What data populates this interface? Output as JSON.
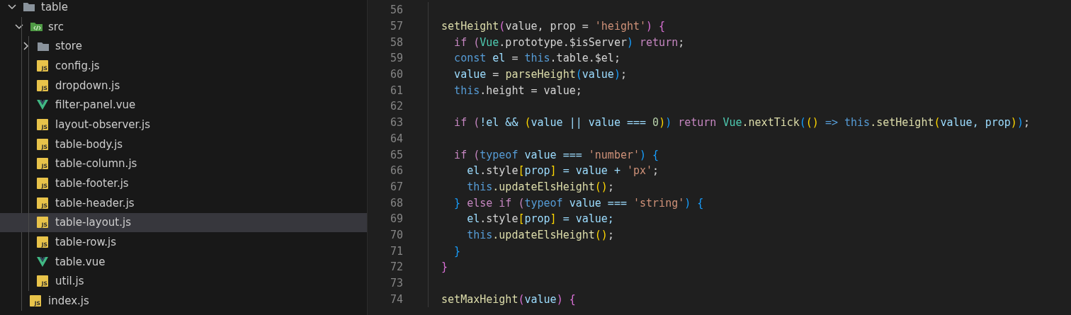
{
  "explorer": {
    "items": [
      {
        "label": "table",
        "kind": "folder",
        "expanded": true,
        "selected": false,
        "children": [
          {
            "label": "src",
            "kind": "source-folder",
            "expanded": true,
            "selected": false,
            "children": [
              {
                "label": "store",
                "kind": "folder",
                "expanded": false,
                "selected": false
              },
              {
                "label": "config.js",
                "kind": "js",
                "icon_text": "JS",
                "selected": false
              },
              {
                "label": "dropdown.js",
                "kind": "js",
                "icon_text": "JS",
                "selected": false
              },
              {
                "label": "filter-panel.vue",
                "kind": "vue",
                "selected": false
              },
              {
                "label": "layout-observer.js",
                "kind": "js",
                "icon_text": "JS",
                "selected": false
              },
              {
                "label": "table-body.js",
                "kind": "js",
                "icon_text": "JS",
                "selected": false
              },
              {
                "label": "table-column.js",
                "kind": "js",
                "icon_text": "JS",
                "selected": false
              },
              {
                "label": "table-footer.js",
                "kind": "js",
                "icon_text": "JS",
                "selected": false
              },
              {
                "label": "table-header.js",
                "kind": "js",
                "icon_text": "JS",
                "selected": false
              },
              {
                "label": "table-layout.js",
                "kind": "js",
                "icon_text": "JS",
                "selected": true
              },
              {
                "label": "table-row.js",
                "kind": "js",
                "icon_text": "JS",
                "selected": false
              },
              {
                "label": "table.vue",
                "kind": "vue",
                "selected": false
              },
              {
                "label": "util.js",
                "kind": "js",
                "icon_text": "JS",
                "selected": false
              }
            ]
          },
          {
            "label": "index.js",
            "kind": "js",
            "icon_text": "JS",
            "selected": false
          }
        ]
      }
    ]
  },
  "editor": {
    "lines": [
      {
        "number": "56"
      },
      {
        "number": "57",
        "tokens": [
          {
            "text": "  setHeight",
            "kind": "fn"
          },
          {
            "text": "(",
            "kind": "b2"
          },
          {
            "text": "value, prop = ",
            "kind": "plain"
          },
          {
            "text": "'height'",
            "kind": "str"
          },
          {
            "text": ") {",
            "kind": "b2"
          }
        ]
      },
      {
        "number": "58",
        "tokens": [
          {
            "text": "    if (",
            "kind": "ctl"
          },
          {
            "text": "Vue",
            "kind": "cls"
          },
          {
            "text": ".prototype.$isServer",
            "kind": "plain"
          },
          {
            "text": ") ",
            "kind": "b3"
          },
          {
            "text": "return",
            "kind": "ctl"
          },
          {
            "text": ";",
            "kind": "plain"
          }
        ]
      },
      {
        "number": "59",
        "tokens": [
          {
            "text": "    const",
            "kind": "kw"
          },
          {
            "text": " el",
            "kind": "var"
          },
          {
            "text": " = ",
            "kind": "plain"
          },
          {
            "text": "this",
            "kind": "kw"
          },
          {
            "text": ".table.$el;",
            "kind": "plain"
          }
        ]
      },
      {
        "number": "60",
        "tokens": [
          {
            "text": "    value",
            "kind": "var"
          },
          {
            "text": " = ",
            "kind": "plain"
          },
          {
            "text": "parseHeight",
            "kind": "fn"
          },
          {
            "text": "(",
            "kind": "b3"
          },
          {
            "text": "value",
            "kind": "var"
          },
          {
            "text": ")",
            "kind": "b3"
          },
          {
            "text": ";",
            "kind": "plain"
          }
        ]
      },
      {
        "number": "61",
        "tokens": [
          {
            "text": "    this",
            "kind": "kw"
          },
          {
            "text": ".height = value;",
            "kind": "plain"
          }
        ]
      },
      {
        "number": "62"
      },
      {
        "number": "63",
        "tokens": [
          {
            "text": "    if (",
            "kind": "ctl"
          },
          {
            "text": "!el && ",
            "kind": "var"
          },
          {
            "text": "(",
            "kind": "b1"
          },
          {
            "text": "value || value === ",
            "kind": "var"
          },
          {
            "text": "0",
            "kind": "num"
          },
          {
            "text": ")",
            "kind": "b1"
          },
          {
            "text": ") ",
            "kind": "b3"
          },
          {
            "text": "return ",
            "kind": "ctl"
          },
          {
            "text": "Vue",
            "kind": "cls"
          },
          {
            "text": ".nextTick",
            "kind": "fn"
          },
          {
            "text": "(",
            "kind": "b3"
          },
          {
            "text": "()",
            "kind": "b1"
          },
          {
            "text": " => this",
            "kind": "kw"
          },
          {
            "text": ".setHeight",
            "kind": "fn"
          },
          {
            "text": "(",
            "kind": "b1"
          },
          {
            "text": "value, prop",
            "kind": "var"
          },
          {
            "text": ")",
            "kind": "b1"
          },
          {
            "text": ")",
            "kind": "b3"
          },
          {
            "text": ";",
            "kind": "plain"
          }
        ]
      },
      {
        "number": "64"
      },
      {
        "number": "65",
        "tokens": [
          {
            "text": "    if (",
            "kind": "ctl"
          },
          {
            "text": "typeof",
            "kind": "kw"
          },
          {
            "text": " value === ",
            "kind": "var"
          },
          {
            "text": "'number'",
            "kind": "str"
          },
          {
            "text": ") {",
            "kind": "b3"
          }
        ]
      },
      {
        "number": "66",
        "tokens": [
          {
            "text": "      el",
            "kind": "var"
          },
          {
            "text": ".style",
            "kind": "plain"
          },
          {
            "text": "[",
            "kind": "b1"
          },
          {
            "text": "prop",
            "kind": "var"
          },
          {
            "text": "]",
            "kind": "b1"
          },
          {
            "text": " = value + ",
            "kind": "var"
          },
          {
            "text": "'px'",
            "kind": "str"
          },
          {
            "text": ";",
            "kind": "plain"
          }
        ]
      },
      {
        "number": "67",
        "tokens": [
          {
            "text": "      this",
            "kind": "kw"
          },
          {
            "text": ".updateElsHeight",
            "kind": "fn"
          },
          {
            "text": "()",
            "kind": "b1"
          },
          {
            "text": ";",
            "kind": "plain"
          }
        ]
      },
      {
        "number": "68",
        "tokens": [
          {
            "text": "    }",
            "kind": "b3"
          },
          {
            "text": " else if (",
            "kind": "ctl"
          },
          {
            "text": "typeof",
            "kind": "kw"
          },
          {
            "text": " value === ",
            "kind": "var"
          },
          {
            "text": "'string'",
            "kind": "str"
          },
          {
            "text": ") {",
            "kind": "b3"
          }
        ]
      },
      {
        "number": "69",
        "tokens": [
          {
            "text": "      el",
            "kind": "var"
          },
          {
            "text": ".style",
            "kind": "plain"
          },
          {
            "text": "[",
            "kind": "b1"
          },
          {
            "text": "prop",
            "kind": "var"
          },
          {
            "text": "]",
            "kind": "b1"
          },
          {
            "text": " = value;",
            "kind": "var"
          }
        ]
      },
      {
        "number": "70",
        "tokens": [
          {
            "text": "      this",
            "kind": "kw"
          },
          {
            "text": ".updateElsHeight",
            "kind": "fn"
          },
          {
            "text": "()",
            "kind": "b1"
          },
          {
            "text": ";",
            "kind": "plain"
          }
        ]
      },
      {
        "number": "71",
        "tokens": [
          {
            "text": "    }",
            "kind": "b3"
          }
        ]
      },
      {
        "number": "72",
        "tokens": [
          {
            "text": "  }",
            "kind": "b2"
          }
        ]
      },
      {
        "number": "73"
      },
      {
        "number": "74",
        "tokens": [
          {
            "text": "  setMaxHeight",
            "kind": "fn"
          },
          {
            "text": "(",
            "kind": "b2"
          },
          {
            "text": "value",
            "kind": "var"
          },
          {
            "text": ") {",
            "kind": "b2"
          }
        ]
      }
    ]
  }
}
